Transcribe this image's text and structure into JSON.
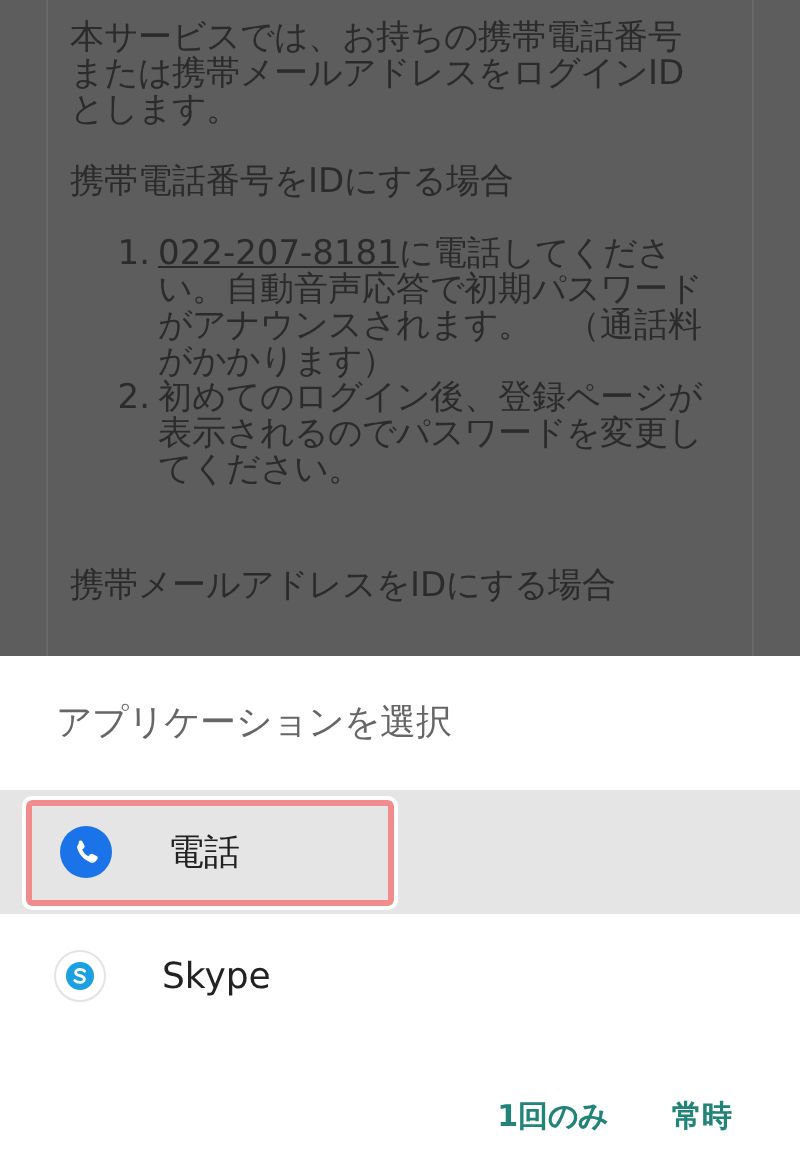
{
  "page": {
    "intro": "本サービスでは、お持ちの携帯電話番号または携帯メールアドレスをログインIDとします。",
    "sections": [
      {
        "heading": "携帯電話番号をIDにする場合",
        "steps": [
          {
            "marker": "1.",
            "link": "022-207-8181",
            "text": "に電話してください。自動音声応答で初期パスワードがアナウンスされます。　（通話料がかかります）"
          },
          {
            "marker": "2.",
            "text": "初めてのログイン後、登録ページが表示されるのでパスワードを変更してください。"
          }
        ]
      },
      {
        "heading": "携帯メールアドレスをIDにする場合"
      }
    ]
  },
  "chooser": {
    "title": "アプリケーションを選択",
    "apps": [
      {
        "kind": "phone",
        "name": "電話",
        "selected": true
      },
      {
        "kind": "skype",
        "name": "Skype",
        "selected": false
      }
    ],
    "buttons": [
      "1回のみ",
      "常時"
    ]
  }
}
